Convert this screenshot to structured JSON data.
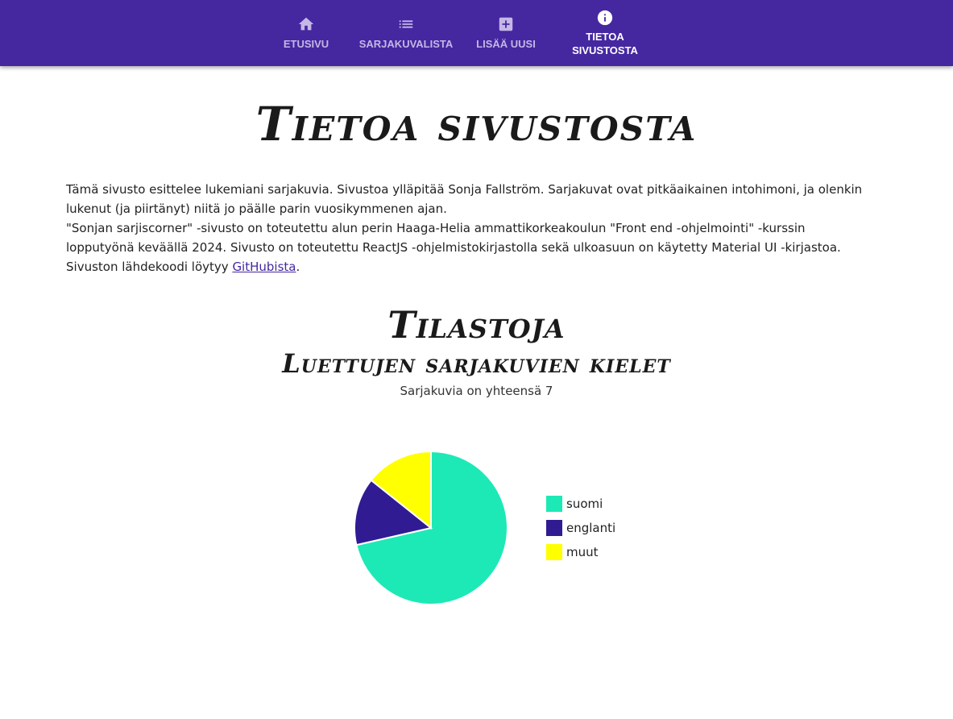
{
  "nav": {
    "items": [
      {
        "label": "ETUSIVU",
        "icon": "home-icon"
      },
      {
        "label": "SARJAKUVALISTA",
        "icon": "list-icon"
      },
      {
        "label": "LISÄÄ UUSI",
        "icon": "add-box-icon"
      },
      {
        "label_line1": "TIETOA",
        "label_line2": "SIVUSTOSTA",
        "icon": "info-icon",
        "active": true
      }
    ],
    "colors": {
      "bar": "#4527a0",
      "inactive": "#c4b7e6",
      "active": "#ffffff"
    }
  },
  "page": {
    "title": "Tietoa sivustosta",
    "intro": {
      "line1": "Tämä sivusto esittelee lukemiani sarjakuvia. Sivustoa ylläpitää Sonja Fallström. Sarjakuvat ovat pitkäaikainen intohimoni, ja olenkin lukenut (ja piirtänyt) niitä jo päälle parin vuosikymmenen ajan.",
      "line2": "\"Sonjan sarjiscorner\" -sivusto on toteutettu alun perin Haaga-Helia ammattikorkeakoulun \"Front end -ohjelmointi\" -kurssin lopputyönä keväällä 2024. Sivusto on toteutettu ReactJS -ohjelmistokirjastolla sekä ulkoasuun on käytetty Material UI -kirjastoa. Sivuston lähdekoodi löytyy ",
      "link_text": "GitHubista",
      "after_link": "."
    }
  },
  "stats": {
    "title": "Tilastoja",
    "subtitle": "Luettujen sarjakuvien kielet",
    "count_text": "Sarjakuvia on yhteensä 7"
  },
  "chart_data": {
    "type": "pie",
    "title": "",
    "categories": [
      "suomi",
      "englanti",
      "muut"
    ],
    "values": [
      5,
      1,
      1
    ],
    "colors": [
      "#1de9b6",
      "#311b92",
      "#ffff00"
    ],
    "legend_position": "right"
  }
}
